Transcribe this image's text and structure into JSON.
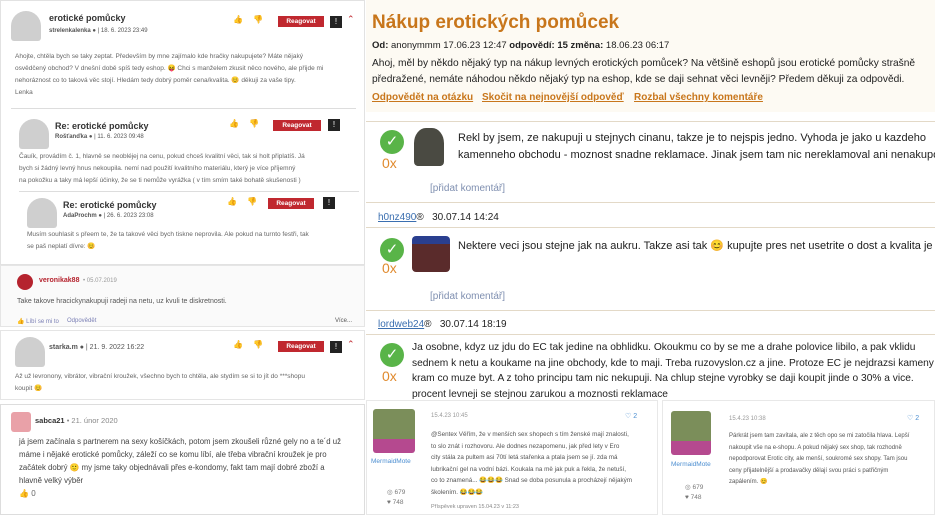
{
  "left_forum": {
    "post1": {
      "title": "erotické pomůcky",
      "author": "strelenkalenka",
      "date": "| 18. 6. 2023 23:49",
      "report": "Reagovat",
      "flag": "!",
      "body": [
        "Ahojte, chtěla bych se taky zeptat. Především by mne zajímalo kde hračky nakupujete? Máte nějaký",
        "osvědčený obchod? V dnešní době spíš tedy eshop. 😝 Chci s manželem zkusit něco nového, ale přijde mi",
        "nehoráznost co to taková věc stojí. Hledám tedy dobrý poměr cena/kvalita. 😊 děkuji za vaše tipy.",
        "Lenka"
      ]
    },
    "post2": {
      "title": "Re: erotické pomůcky",
      "author": "Rošťanďka",
      "date": "| 11. 6. 2023 09:48",
      "report": "Reagovat",
      "flag": "!",
      "body": [
        "Čauík, provádím č. 1, hlavně se neobléjej na cenu, pokud chceš kvalitní věci, tak si holt připlatíš. Já",
        "bych si žádný levný hnus nekoupila. nemí nad použití kvalitního materiálu, který je více příjemný",
        "na pokožku a taky má lepší účinky, že se ti nemůže vyrážka ( v tím smím také bohatě skušenosti )"
      ]
    },
    "post3": {
      "title": "Re: erotické pomůcky",
      "author": "AdaProchm",
      "date": "| 26. 6. 2023 23:08",
      "report": "Reagovat",
      "flag": "!",
      "body": [
        "Musím souhlasit s přeem te, že ta takové věci bych tiskne neprovila. Ale pokud na turnto festři, tak",
        "se paš neplatí dívre: 😊"
      ]
    },
    "post4": {
      "author": "veronikak88",
      "date": "• 05.07.2019",
      "body": "Take takove hracickynakupuji radeji na netu, uz kvuli te diskretnosti.",
      "like": "Líbí se mi to",
      "reply": "Odpovědět",
      "more": "Více..."
    },
    "post5": {
      "author": "starka.m",
      "date": "| 21. 9. 2022 16:22",
      "report": "Reagovat",
      "flag": "!",
      "body": [
        "Až už levronony, vibrátor, vibrační kroužek, všechno bych to chtěla, ale stydím se si to jít do ***shopu",
        "koupit 😊"
      ]
    },
    "post6": {
      "author": "sabca21",
      "date": "• 21. únor 2020",
      "body": [
        "já jsem začínala s partnerem na sexy košíčkách, potom jsem zkoušeli různé gely no a te´d už",
        "máme i nějaké erotické pomůcky, záleží co se komu líbí, ale třeba vibrační kroužek je pro",
        "začátek dobrý 🙂 my jsme taky objednávali přes e-kondomy, fakt tam mají dobré zboží a",
        "hlavně velký výběr"
      ],
      "likes": "0"
    }
  },
  "right_forum": {
    "title": "Nákup erotických pomůcek",
    "meta": {
      "od_label": "Od:",
      "od_value": "anonymmm 17.06.23 12:47",
      "odp_label": "odpovědí:",
      "odp_value": "15",
      "zm_label": "změna:",
      "zm_value": "18.06.23 06:17"
    },
    "question": [
      "Ahoj, měl by někdo nějaký typ na nákup levných erotických pomůcek? Na většině eshopů jsou erotické pomůcky strašně",
      "předražené, nemáte náhodou někdo nějaký typ na eshop, kde se daji sehnat věci levněji? Předem děkuji za odpovědi."
    ],
    "links": {
      "reply": "Odpovědět na otázku",
      "jump": "Skočit na nejnovější odpověď",
      "expand": "Rozbal všechny komentáře"
    },
    "answers": [
      {
        "votes": "0x",
        "lines": [
          "Rekl by jsem, ze nakupuji u stejnych cinanu, takze je to nejspis jedno. Vyhoda je jako u kazdeho",
          "kamenneho obchodu - moznost snadne reklamace. Jinak jsem tam nic nereklamoval ani nenakupoval"
        ],
        "add": "[přidat komentář]",
        "user": "h0nz490",
        "user_mark": "®",
        "date": "30.07.14 14:24"
      },
      {
        "votes": "0x",
        "lines": [
          "Nektere veci jsou stejne jak na aukru. Takze asi tak 😊 kupujte pres net usetrite o dost a kvalita je stejna."
        ],
        "add": "[přidat komentář]",
        "user": "lordweb24",
        "user_mark": "®",
        "date": "30.07.14 18:19"
      },
      {
        "votes": "0x",
        "lines": [
          "Ja osobne, kdyz uz jdu do EC tak jedine na obhlidku. Okoukmu co by se me a drahe polovice libilo, a pak vklidu",
          "sednem k netu a koukame na jine obchody, kde to maji. Treba ruzovyslon.cz a jine. Protoze EC je nejdrazsi kameny",
          "kram co muze byt. A z toho principu tam nic nekupuji. Na chlup stejne vyrobky se daji koupit jinde o 30% a vice.",
          "procent levneji se stejnou zarukou a moznosti reklamace"
        ]
      }
    ]
  },
  "bottom_cards": [
    {
      "username": "MermaidMote",
      "views": "679",
      "hearts": "748",
      "date": "15.4.23 10:45",
      "likes": "2",
      "lines": [
        "@Sentex Věřím, že v menších sex shopech s tím ženské mají znalosti,",
        "to slo znát i rozhovoru. Ale dodnes nezapomenu, jak před lety v Ero",
        "city stála za pultem asi 70tí letá stařenka a ptala jsem se jí. zda má",
        "lubrikační gel na vodní bázi. Koukala na mě jak puk a řekla, že netuší,",
        "co to znamená... 😂😂😂 Snad se doba posunula a procházejí nějakým",
        "školením. 😂😂😂"
      ],
      "footer": "Příspěvek upraven 15.04.23 v 11:23"
    },
    {
      "username": "MermaidMote",
      "views": "679",
      "hearts": "748",
      "date": "15.4.23 10:38",
      "likes": "2",
      "lines": [
        "Párkrát jsem tam zavítala, ale z těch opo se mi zatočila hlava. Lepší",
        "nakoupit vše na e-shopu. A pokud nějaký sex shop, tak rozhodně",
        "nepodporovat Erotic city, ale menší, soukromé sex shopy. Tam jsou",
        "ceny přijatelnější a prodavačky dělají svou práci s patřičným",
        "zapálením. 😊"
      ]
    }
  ],
  "colors": {
    "accent_red": "#c0282f",
    "title_orange": "#c8761b",
    "check_green": "#59b448",
    "link_orange": "#c8761b"
  }
}
